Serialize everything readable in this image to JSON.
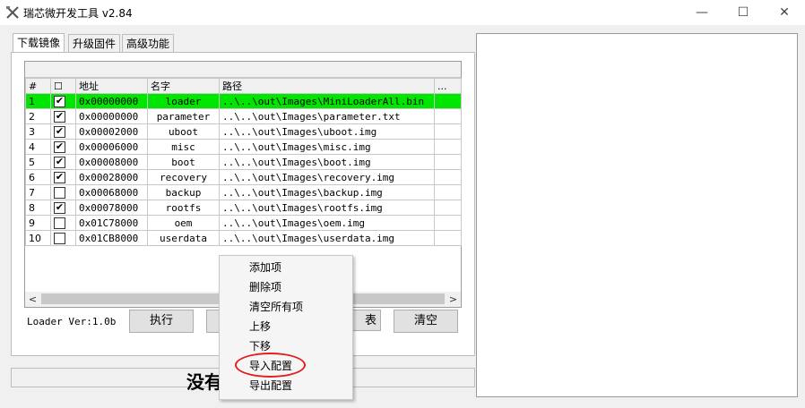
{
  "window": {
    "title": "瑞芯微开发工具 v2.84",
    "icon": "crossed-tools-icon",
    "controls": {
      "minimize": "—",
      "maximize": "☐",
      "close": "✕"
    }
  },
  "tabs": [
    {
      "label": "下载镜像",
      "active": true
    },
    {
      "label": "升级固件",
      "active": false
    },
    {
      "label": "高级功能",
      "active": false
    }
  ],
  "table": {
    "headers": [
      "#",
      "☐",
      "地址",
      "名字",
      "路径",
      "..."
    ],
    "rows": [
      {
        "num": "1",
        "checked": true,
        "address": "0x00000000",
        "name": "loader",
        "path": "..\\..\\out\\Images\\MiniLoaderAll.bin",
        "selected": true
      },
      {
        "num": "2",
        "checked": true,
        "address": "0x00000000",
        "name": "parameter",
        "path": "..\\..\\out\\Images\\parameter.txt",
        "selected": false
      },
      {
        "num": "3",
        "checked": true,
        "address": "0x00002000",
        "name": "uboot",
        "path": "..\\..\\out\\Images\\uboot.img",
        "selected": false
      },
      {
        "num": "4",
        "checked": true,
        "address": "0x00006000",
        "name": "misc",
        "path": "..\\..\\out\\Images\\misc.img",
        "selected": false
      },
      {
        "num": "5",
        "checked": true,
        "address": "0x00008000",
        "name": "boot",
        "path": "..\\..\\out\\Images\\boot.img",
        "selected": false
      },
      {
        "num": "6",
        "checked": true,
        "address": "0x00028000",
        "name": "recovery",
        "path": "..\\..\\out\\Images\\recovery.img",
        "selected": false
      },
      {
        "num": "7",
        "checked": false,
        "address": "0x00068000",
        "name": "backup",
        "path": "..\\..\\out\\Images\\backup.img",
        "selected": false
      },
      {
        "num": "8",
        "checked": true,
        "address": "0x00078000",
        "name": "rootfs",
        "path": "..\\..\\out\\Images\\rootfs.img",
        "selected": false
      },
      {
        "num": "9",
        "checked": false,
        "address": "0x01C78000",
        "name": "oem",
        "path": "..\\..\\out\\Images\\oem.img",
        "selected": false
      },
      {
        "num": "10",
        "checked": false,
        "address": "0x01CB8000",
        "name": "userdata",
        "path": "..\\..\\out\\Images\\userdata.img",
        "selected": false
      }
    ]
  },
  "loader_version": "Loader Ver:1.0b",
  "buttons": {
    "execute": "执行",
    "partial": "表",
    "clear": "清空"
  },
  "status_text": "没有",
  "context_menu": {
    "items": [
      "添加项",
      "删除项",
      "清空所有项",
      "上移",
      "下移",
      "导入配置",
      "导出配置"
    ],
    "highlighted": "导入配置",
    "highlight_color": "#e02020"
  },
  "colors": {
    "selected_row": "#00e600"
  }
}
